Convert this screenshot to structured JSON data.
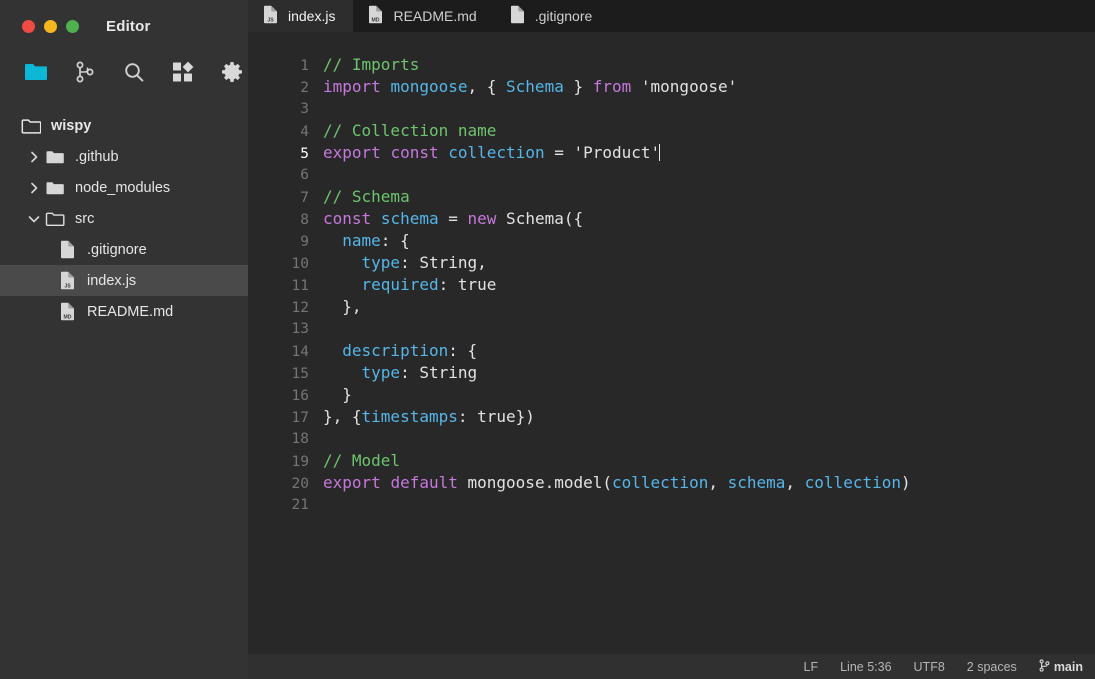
{
  "window": {
    "title": "Editor",
    "traffic_lights": [
      "close",
      "minimize",
      "maximize"
    ]
  },
  "activitybar": {
    "items": [
      {
        "name": "explorer-icon",
        "label": "Explorer",
        "active": true,
        "color": "#0cb8d6"
      },
      {
        "name": "source-control-icon",
        "label": "Source Control",
        "active": false
      },
      {
        "name": "search-icon",
        "label": "Search",
        "active": false
      },
      {
        "name": "extensions-icon",
        "label": "Extensions",
        "active": false
      },
      {
        "name": "settings-gear-icon",
        "label": "Settings",
        "active": false
      }
    ]
  },
  "sidebar": {
    "root": {
      "label": "wispy",
      "icon": "folder-icon"
    },
    "tree": [
      {
        "label": ".github",
        "type": "folder",
        "depth": 1,
        "expanded": false,
        "chevron": "chevron-right-icon",
        "selected": false
      },
      {
        "label": "node_modules",
        "type": "folder",
        "depth": 1,
        "expanded": false,
        "chevron": "chevron-right-icon",
        "selected": false
      },
      {
        "label": "src",
        "type": "folder",
        "depth": 1,
        "expanded": true,
        "chevron": "chevron-down-icon",
        "selected": false
      },
      {
        "label": ".gitignore",
        "type": "file",
        "depth": 2,
        "badge": "",
        "selected": false
      },
      {
        "label": "index.js",
        "type": "file",
        "depth": 2,
        "badge": "JS",
        "selected": true
      },
      {
        "label": "README.md",
        "type": "file",
        "depth": 2,
        "badge": "MD",
        "selected": false
      }
    ]
  },
  "tabs": [
    {
      "label": "index.js",
      "badge": "JS",
      "active": true
    },
    {
      "label": "README.md",
      "badge": "MD",
      "active": false
    },
    {
      "label": ".gitignore",
      "badge": "",
      "active": false
    }
  ],
  "editor": {
    "current_line": 5,
    "lines": [
      {
        "n": "1",
        "tokens": [
          {
            "t": "// Imports",
            "c": "cmt"
          }
        ]
      },
      {
        "n": "2",
        "tokens": [
          {
            "t": "import",
            "c": "kw"
          },
          {
            "t": " ",
            "c": "pl"
          },
          {
            "t": "mongoose",
            "c": "id"
          },
          {
            "t": ", { ",
            "c": "pl"
          },
          {
            "t": "Schema",
            "c": "id"
          },
          {
            "t": " } ",
            "c": "pl"
          },
          {
            "t": "from",
            "c": "kw"
          },
          {
            "t": " 'mongoose'",
            "c": "str"
          }
        ]
      },
      {
        "n": "3",
        "tokens": []
      },
      {
        "n": "4",
        "tokens": [
          {
            "t": "// Collection name",
            "c": "cmt"
          }
        ]
      },
      {
        "n": "5",
        "tokens": [
          {
            "t": "export",
            "c": "kw"
          },
          {
            "t": " ",
            "c": "pl"
          },
          {
            "t": "const",
            "c": "kw"
          },
          {
            "t": " ",
            "c": "pl"
          },
          {
            "t": "collection",
            "c": "id"
          },
          {
            "t": " = ",
            "c": "pl"
          },
          {
            "t": "'Product'",
            "c": "str"
          },
          {
            "t": "|",
            "c": "caret"
          }
        ]
      },
      {
        "n": "6",
        "tokens": []
      },
      {
        "n": "7",
        "tokens": [
          {
            "t": "// Schema",
            "c": "cmt"
          }
        ]
      },
      {
        "n": "8",
        "tokens": [
          {
            "t": "const",
            "c": "kw"
          },
          {
            "t": " ",
            "c": "pl"
          },
          {
            "t": "schema",
            "c": "id"
          },
          {
            "t": " = ",
            "c": "pl"
          },
          {
            "t": "new",
            "c": "kw"
          },
          {
            "t": " Schema({",
            "c": "pl"
          }
        ]
      },
      {
        "n": "9",
        "tokens": [
          {
            "t": "  ",
            "c": "pl"
          },
          {
            "t": "name",
            "c": "id"
          },
          {
            "t": ": {",
            "c": "pl"
          }
        ]
      },
      {
        "n": "10",
        "tokens": [
          {
            "t": "    ",
            "c": "pl"
          },
          {
            "t": "type",
            "c": "id"
          },
          {
            "t": ": String,",
            "c": "pl"
          }
        ]
      },
      {
        "n": "11",
        "tokens": [
          {
            "t": "    ",
            "c": "pl"
          },
          {
            "t": "required",
            "c": "id"
          },
          {
            "t": ": true",
            "c": "pl"
          }
        ]
      },
      {
        "n": "12",
        "tokens": [
          {
            "t": "  },",
            "c": "pl"
          }
        ]
      },
      {
        "n": "13",
        "tokens": []
      },
      {
        "n": "14",
        "tokens": [
          {
            "t": "  ",
            "c": "pl"
          },
          {
            "t": "description",
            "c": "id"
          },
          {
            "t": ": {",
            "c": "pl"
          }
        ]
      },
      {
        "n": "15",
        "tokens": [
          {
            "t": "    ",
            "c": "pl"
          },
          {
            "t": "type",
            "c": "id"
          },
          {
            "t": ": String",
            "c": "pl"
          }
        ]
      },
      {
        "n": "16",
        "tokens": [
          {
            "t": "  }",
            "c": "pl"
          }
        ]
      },
      {
        "n": "17",
        "tokens": [
          {
            "t": "}, {",
            "c": "pl"
          },
          {
            "t": "timestamps",
            "c": "id"
          },
          {
            "t": ": true})",
            "c": "pl"
          }
        ]
      },
      {
        "n": "18",
        "tokens": []
      },
      {
        "n": "19",
        "tokens": [
          {
            "t": "// Model",
            "c": "cmt"
          }
        ]
      },
      {
        "n": "20",
        "tokens": [
          {
            "t": "export",
            "c": "kw"
          },
          {
            "t": " ",
            "c": "pl"
          },
          {
            "t": "default",
            "c": "kw"
          },
          {
            "t": " mongoose.model(",
            "c": "pl"
          },
          {
            "t": "collection",
            "c": "id"
          },
          {
            "t": ", ",
            "c": "pl"
          },
          {
            "t": "schema",
            "c": "id"
          },
          {
            "t": ", ",
            "c": "pl"
          },
          {
            "t": "collection",
            "c": "id"
          },
          {
            "t": ")",
            "c": "pl"
          }
        ]
      },
      {
        "n": "21",
        "tokens": []
      }
    ]
  },
  "statusbar": {
    "eol": "LF",
    "cursor": "Line 5:36",
    "encoding": "UTF8",
    "indentation": "2 spaces",
    "branch": "main",
    "branch_icon": "git-branch-icon"
  },
  "colors": {
    "sidebar_bg": "#333333",
    "editor_bg": "#282828",
    "tabbar_bg": "#1c1c1c",
    "active_tab_bg": "#2d2d2d",
    "selection_bg": "#4a4a4a",
    "statusbar_bg": "#303030",
    "accent": "#0cb8d6",
    "keyword": "#c678dd",
    "comment": "#6ec46e",
    "identifier": "#56b6e8",
    "text": "#e2e2e2"
  }
}
